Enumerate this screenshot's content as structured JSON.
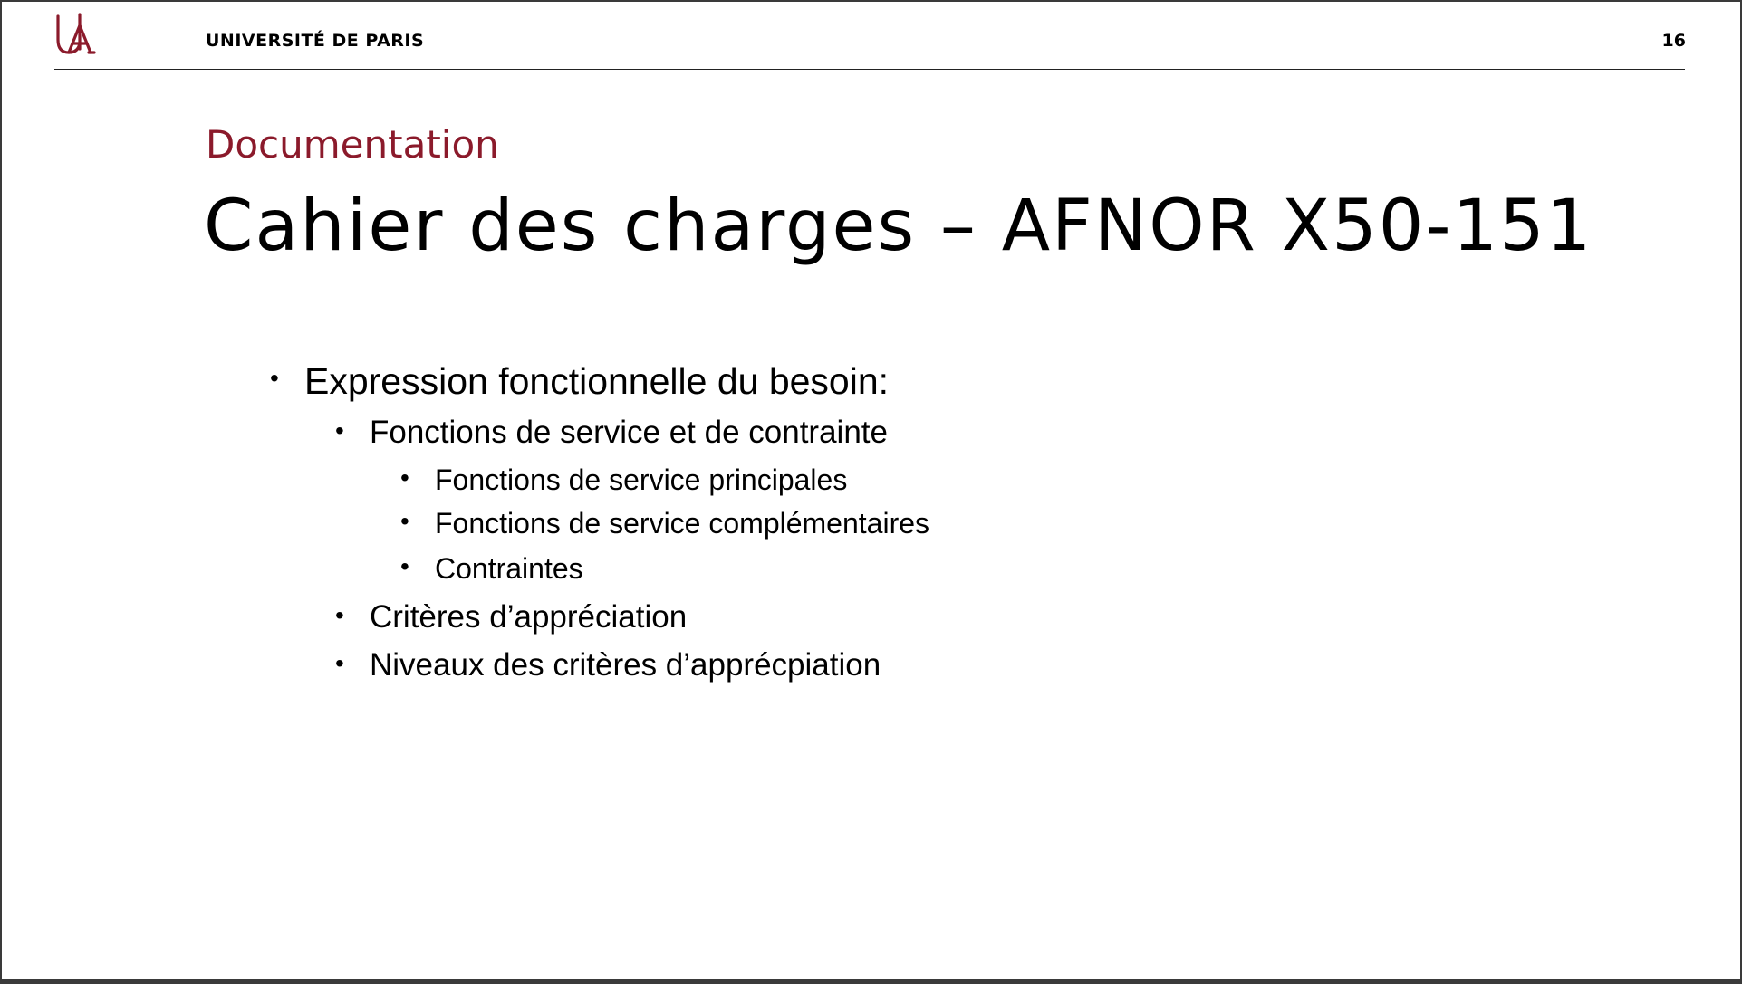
{
  "header": {
    "institution": "UNIVERSITÉ DE PARIS",
    "page_number": "16",
    "logo_icon": "universite-de-paris-logo",
    "brand_color": "#8b1a2b"
  },
  "slide": {
    "section": "Documentation",
    "title": "Cahier des charges – AFNOR X50-151"
  },
  "bullets": [
    {
      "level": 1,
      "text": "Expression fonctionnelle du besoin:"
    },
    {
      "level": 2,
      "text": "Fonctions de service et de contrainte"
    },
    {
      "level": 3,
      "text": "Fonctions de service principales"
    },
    {
      "level": 3,
      "text": "Fonctions de service complémentaires"
    },
    {
      "level": 3,
      "text": "Contraintes"
    },
    {
      "level": 2,
      "text": "Critères d’appréciation"
    },
    {
      "level": 2,
      "text": "Niveaux des critères d’apprécpiation"
    }
  ]
}
